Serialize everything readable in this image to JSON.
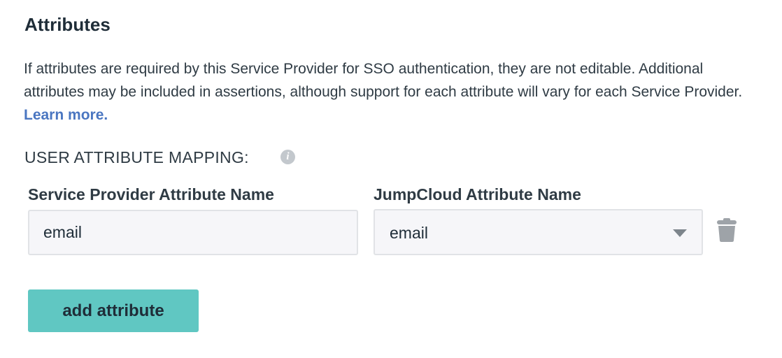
{
  "section": {
    "title": "Attributes",
    "description": "If attributes are required by this Service Provider for SSO authentication, they are not editable. Additional attributes may be included in assertions, although support for each attribute will vary for each Service Provider. ",
    "learn_more_label": "Learn more.",
    "link_color": "#4a76c1"
  },
  "mapping": {
    "label": "USER ATTRIBUTE MAPPING:",
    "info_icon": "info-icon",
    "headers": {
      "service_provider": "Service Provider Attribute Name",
      "jumpcloud": "JumpCloud Attribute Name"
    },
    "rows": [
      {
        "service_provider_value": "email",
        "jumpcloud_value": "email",
        "delete_icon": "trash-icon"
      }
    ]
  },
  "actions": {
    "add_attribute_label": "add attribute",
    "add_attribute_color": "#60c7c2"
  }
}
